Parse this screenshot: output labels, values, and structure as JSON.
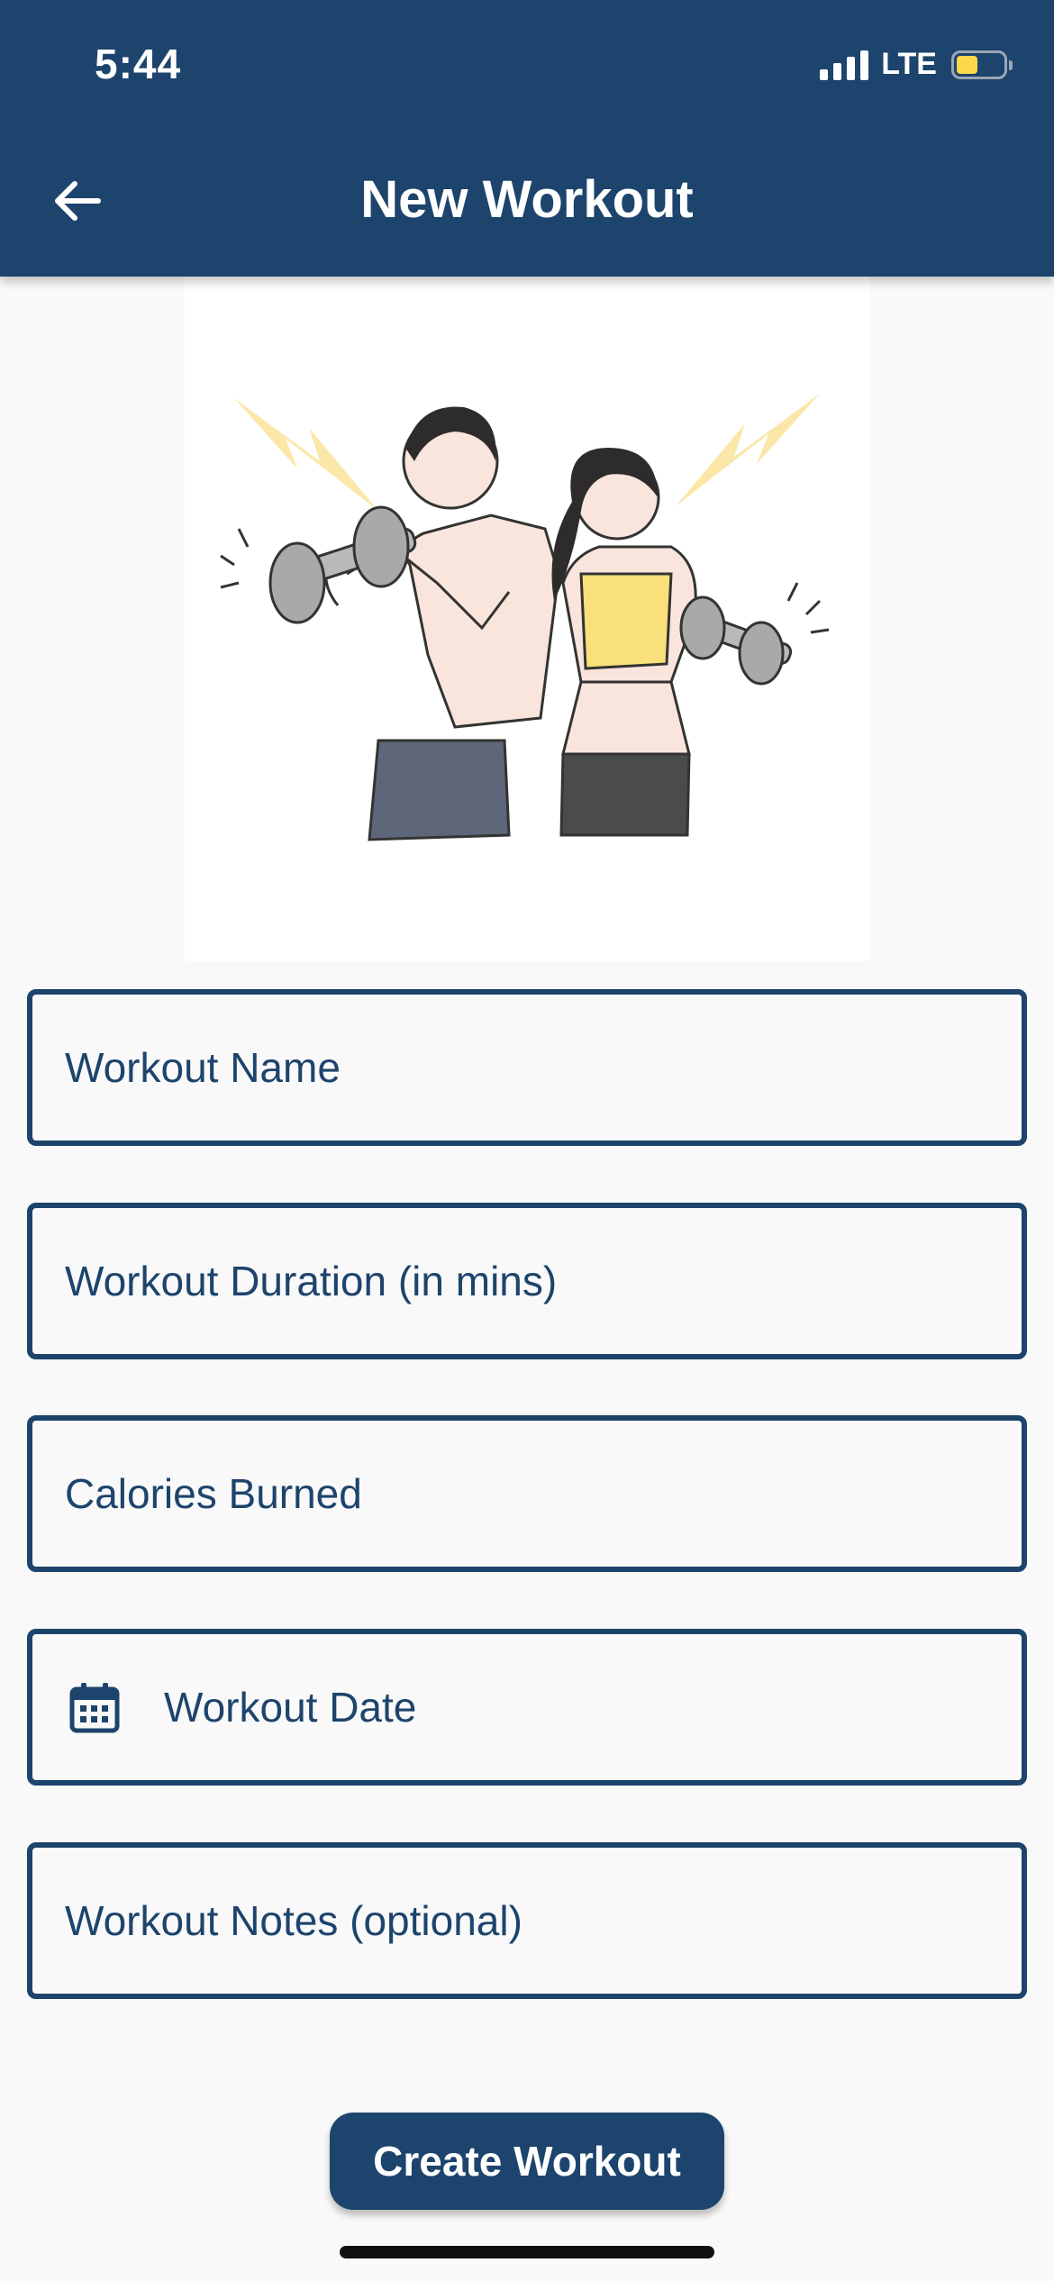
{
  "status_bar": {
    "time": "5:44",
    "network": "LTE",
    "battery_level": 0.45
  },
  "header": {
    "title": "New Workout",
    "back_icon": "arrow-left-icon"
  },
  "hero": {
    "illustration": "workout-couple-dumbbells-illustration"
  },
  "form": {
    "workout_name": "Workout Name",
    "workout_duration": "Workout Duration (in mins)",
    "calories_burned": "Calories Burned",
    "workout_date": "Workout Date",
    "workout_date_icon": "calendar-icon",
    "workout_notes": "Workout Notes (optional)"
  },
  "actions": {
    "create_label": "Create Workout"
  },
  "colors": {
    "primary": "#1d446c",
    "background": "#f9f9f9",
    "battery": "#ffd84a"
  }
}
